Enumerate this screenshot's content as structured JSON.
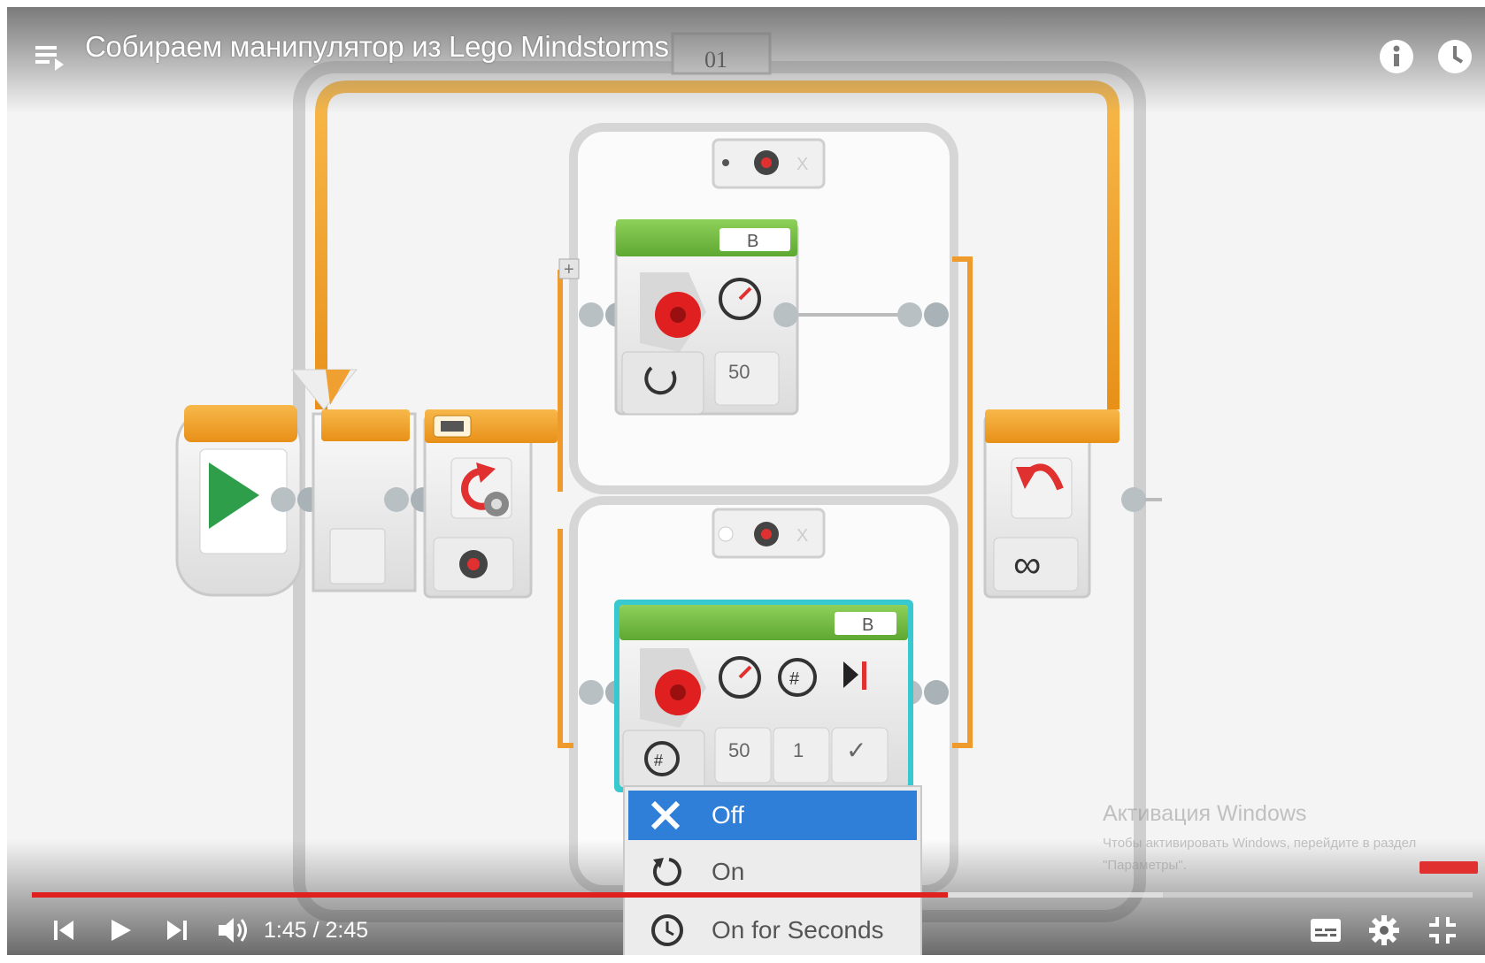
{
  "video": {
    "title": "Собираем манипулятор из Lego Mindstorms",
    "current_time": "1:45",
    "duration": "2:45",
    "time_display": "1:45 / 2:45",
    "progress_fraction": 0.636,
    "buffered_fraction": 0.785
  },
  "program": {
    "comment_label": "01",
    "motor_top": {
      "port": "B",
      "power": "50"
    },
    "motor_bottom": {
      "port": "B",
      "power": "50",
      "rotations": "1",
      "brake": "✓"
    },
    "loop_count_symbol": "∞"
  },
  "mode_menu": {
    "items": [
      {
        "label": "Off",
        "icon": "x-icon",
        "selected": true
      },
      {
        "label": "On",
        "icon": "rotate-icon",
        "selected": false
      },
      {
        "label": "On for Seconds",
        "icon": "timer-icon",
        "selected": false
      }
    ]
  },
  "watermark": {
    "line1": "Активация Windows",
    "line2": "Чтобы активировать Windows, перейдите в раздел \"Параметры\"."
  },
  "colors": {
    "progress_red": "#e0201f",
    "loop_orange": "#f0a030",
    "motor_green": "#6cb83a",
    "selected_blue": "#2f7fd8"
  }
}
